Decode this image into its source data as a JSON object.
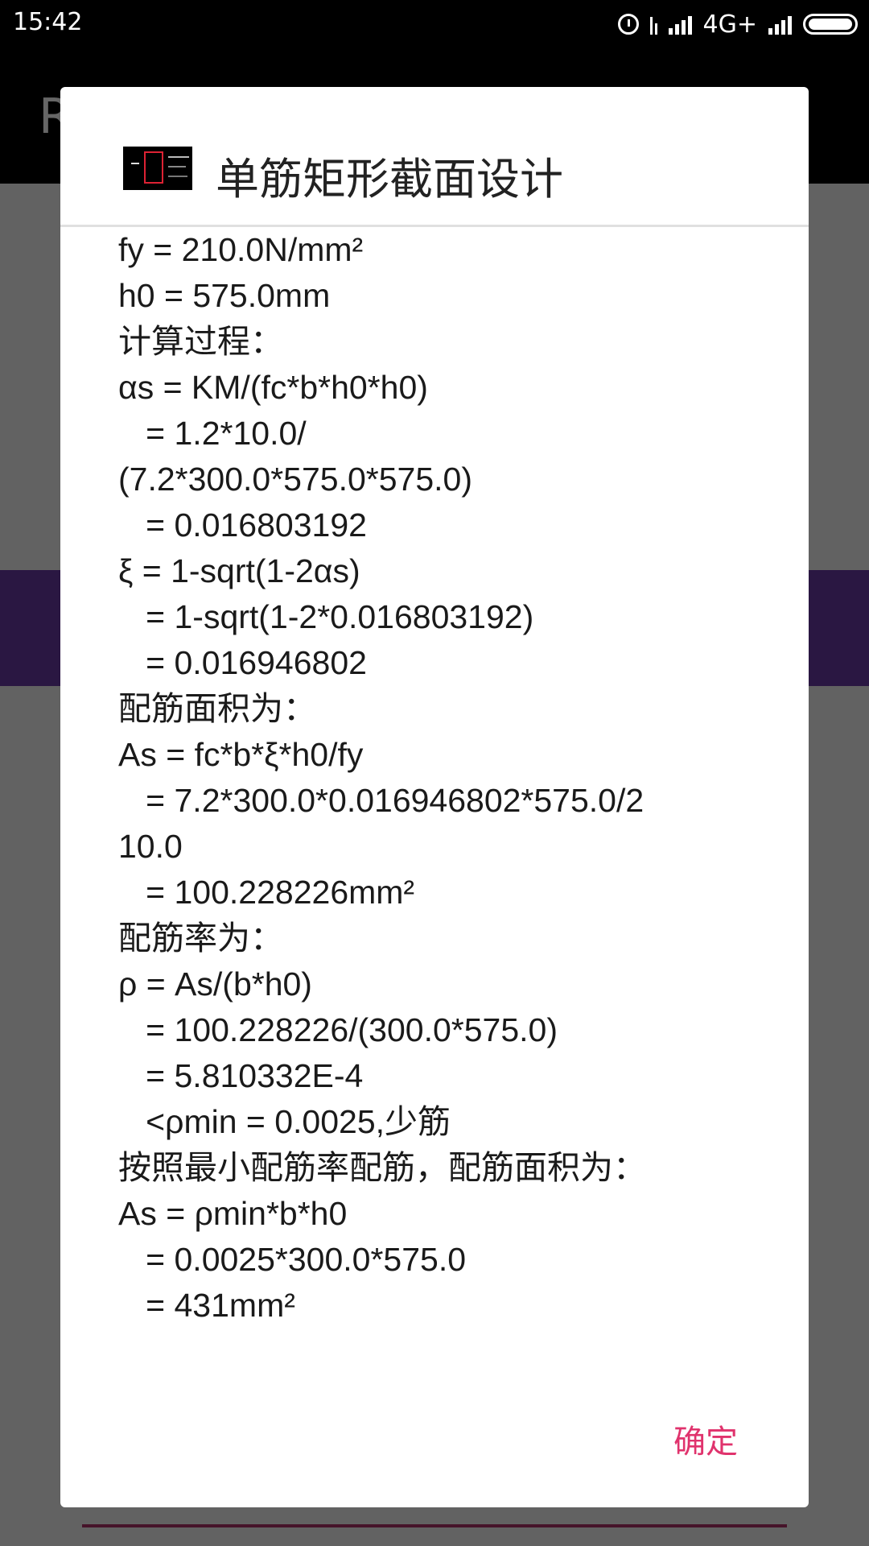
{
  "status_bar": {
    "time": "15:42",
    "network": "4G+"
  },
  "app": {
    "title_initial": "R"
  },
  "dialog": {
    "title": "单筋矩形截面设计",
    "icon": "app-thumbnail-icon",
    "lines": [
      "fy = 210.0N/mm²",
      "h0 = 575.0mm",
      "计算过程：",
      "αs = KM/(fc*b*h0*h0)",
      "   = 1.2*10.0/",
      "(7.2*300.0*575.0*575.0)",
      "   = 0.016803192",
      "ξ = 1-sqrt(1-2αs)",
      "   = 1-sqrt(1-2*0.016803192)",
      "   = 0.016946802",
      "配筋面积为：",
      "As = fc*b*ξ*h0/fy",
      "   = 7.2*300.0*0.016946802*575.0/2",
      "10.0",
      "   = 100.228226mm²",
      "配筋率为：",
      "ρ = As/(b*h0)",
      "   = 100.228226/(300.0*575.0)",
      "   = 5.810332E-4",
      "   <ρmin = 0.0025,少筋",
      "按照最小配筋率配筋，配筋面积为：",
      "As = ρmin*b*h0",
      "   = 0.0025*300.0*575.0",
      "   = 431mm²"
    ],
    "confirm_label": "确定"
  },
  "colors": {
    "accent": "#e0336d",
    "purple_band": "#6a3aa5"
  }
}
